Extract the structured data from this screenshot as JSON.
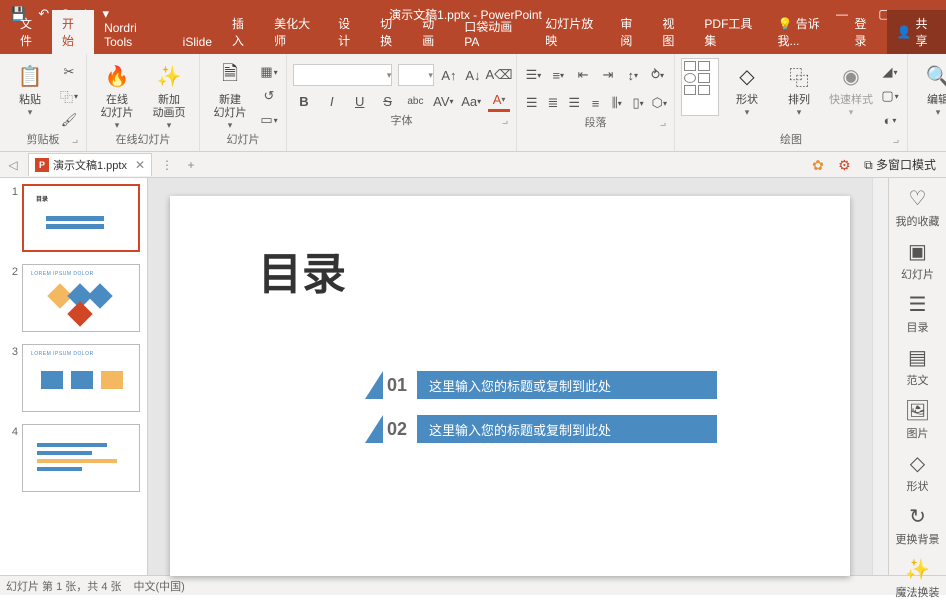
{
  "app": {
    "title": "演示文稿1.pptx - PowerPoint"
  },
  "qat": {
    "save": "💾",
    "undo": "↶",
    "redo": "↷",
    "start": "⏵",
    "more": "▾"
  },
  "window": {
    "min": "—",
    "max": "▢",
    "close": "✕"
  },
  "tabs": {
    "file": "文件",
    "home": "开始",
    "nordri": "Nordri Tools",
    "islide": "iSlide",
    "insert": "插入",
    "beautify": "美化大师",
    "design": "设计",
    "transition": "切换",
    "animation": "动画",
    "pocket": "口袋动画 PA",
    "slideshow": "幻灯片放映",
    "review": "审阅",
    "view": "视图",
    "pdf": "PDF工具集",
    "tellme_icon": "💡",
    "tellme": "告诉我...",
    "login": "登录",
    "share_icon": "👤",
    "share": "共享"
  },
  "ribbon": {
    "clipboard": {
      "paste": "粘贴",
      "label": "剪贴板"
    },
    "slides_online": {
      "online": "在线\n幻灯片",
      "newanim": "新加\n动画页",
      "newslide": "新建\n幻灯片",
      "label": "在线幻灯片",
      "label2": "幻灯片"
    },
    "font": {
      "label": "字体",
      "bold": "B",
      "italic": "I",
      "underline": "U",
      "strike": "S",
      "shadow": "abc"
    },
    "paragraph": {
      "label": "段落"
    },
    "drawing": {
      "shapes": "形状",
      "arrange": "排列",
      "quickstyle": "快速样式",
      "label": "绘图"
    },
    "editing": {
      "find_icon": "🔍",
      "edit": "编辑"
    }
  },
  "doctab": {
    "name": "演示文稿1.pptx",
    "multiwindow": "多窗口模式"
  },
  "slide": {
    "title": "目录",
    "items": [
      {
        "num": "01",
        "text": "这里输入您的标题或复制到此处"
      },
      {
        "num": "02",
        "text": "这里输入您的标题或复制到此处"
      }
    ]
  },
  "sidepanel": {
    "fav": "我的收藏",
    "slides": "幻灯片",
    "toc": "目录",
    "template": "范文",
    "image": "图片",
    "shape": "形状",
    "bg": "更换背景",
    "magic": "魔法换装"
  },
  "thumbs": {
    "t2_title": "LOREM IPSUM DOLOR",
    "t3_title": "LOREM IPSUM DOLOR"
  },
  "status": {
    "left": "幻灯片 第 1 张，共 4 张",
    "lang": "中文(中国)"
  }
}
